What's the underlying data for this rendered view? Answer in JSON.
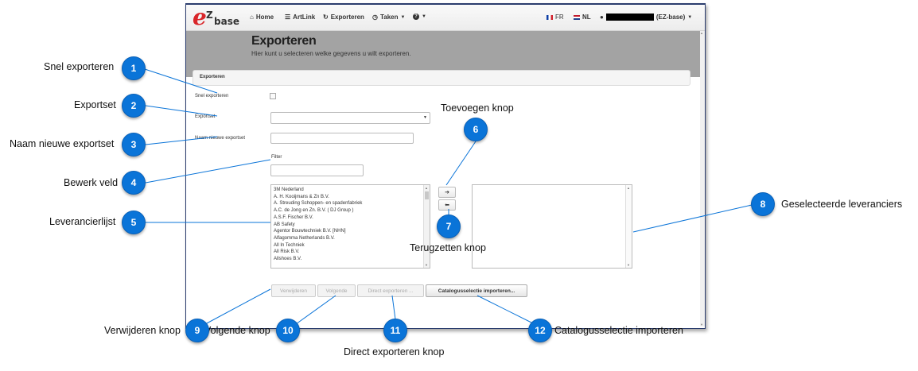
{
  "navbar": {
    "logo_letter": "e",
    "logo_z": "Z",
    "logo_base": "base",
    "home": "Home",
    "artlink": "ArtLink",
    "exporteren": "Exporteren",
    "taken": "Taken",
    "help_icon": "?",
    "lang_fr": "FR",
    "lang_nl": "NL",
    "user_suffix": "(EZ-base)"
  },
  "header": {
    "title": "Exporteren",
    "subtitle": "Hier kunt u selecteren welke gegevens u wilt exporteren."
  },
  "panel": {
    "title": "Exporteren"
  },
  "form": {
    "snel_label": "Snel exporteren",
    "exportset_label": "Exportset",
    "exportset_value": "",
    "naam_label": "Naam nieuwe exportset",
    "naam_value": "",
    "filter_label": "Filter",
    "filter_value": ""
  },
  "suppliers": [
    "3M Nederland",
    "A. H. Kooijmans & Zn B.V.",
    "A. Streuding Schoppen- en spadenfabriek",
    "A.C. de Jong en Zn. B.V. ( DJ Group )",
    "A.S.F. Fischer B.V.",
    "AB Safety",
    "Agentor Bouwtechniek B.V. [NHN]",
    "Alfagomma Netherlands B.V.",
    "All In Techniek",
    "All Risk B.V.",
    "Allshoes B.V."
  ],
  "arrows": {
    "add": "➔",
    "back": "⬅"
  },
  "buttons": {
    "verwijderen": "Verwijderen",
    "volgende": "Volgende",
    "direct": "Direct exporteren ...",
    "catalogus": "Catalogusselectie importeren..."
  },
  "annotations": [
    {
      "num": "1",
      "text": "Snel exporteren"
    },
    {
      "num": "2",
      "text": "Exportset"
    },
    {
      "num": "3",
      "text": "Naam nieuwe exportset"
    },
    {
      "num": "4",
      "text": "Bewerk veld"
    },
    {
      "num": "5",
      "text": "Leverancierlijst"
    },
    {
      "num": "6",
      "text": "Toevoegen knop"
    },
    {
      "num": "7",
      "text": "Terugzetten knop"
    },
    {
      "num": "8",
      "text": "Geselecteerde leveranciers"
    },
    {
      "num": "9",
      "text": "Verwijderen knop"
    },
    {
      "num": "10",
      "text": "Volgende knop"
    },
    {
      "num": "11",
      "text": "Direct exporteren knop"
    },
    {
      "num": "12",
      "text": "Catalogusselectie importeren"
    }
  ],
  "colors": {
    "badge": "#0a74d8",
    "header_band": "#a3a3a3",
    "logo_red": "#d9262a",
    "window_border": "#2b3d6e"
  }
}
